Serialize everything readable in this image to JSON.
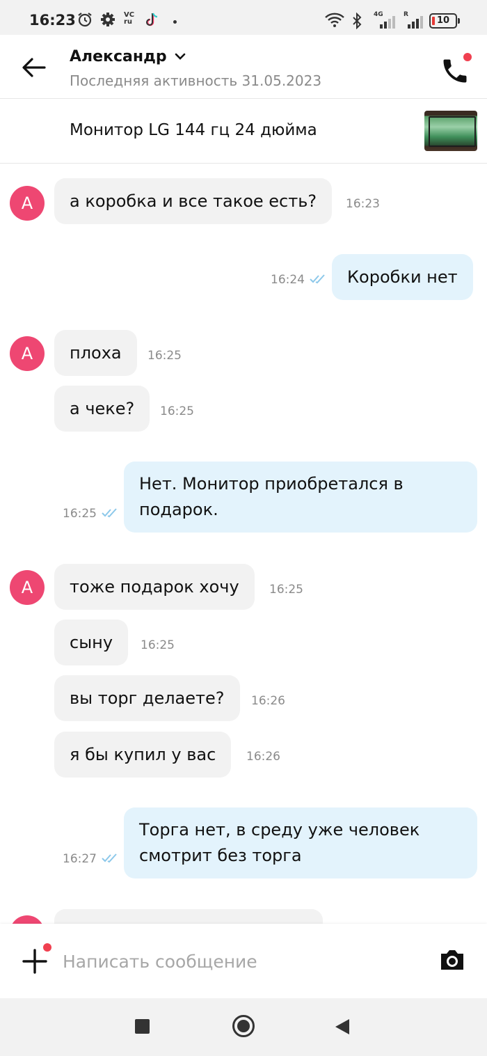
{
  "status_bar": {
    "time": "16:23",
    "icons": [
      "alarm-icon",
      "settings-icon",
      "vc-ru-icon",
      "tiktok-icon",
      "wifi-icon",
      "bluetooth-icon",
      "signal-4g-icon",
      "signal-roaming-icon"
    ],
    "vc_label": "VC\nru",
    "net_4g": "4G",
    "net_r": "R",
    "battery": "10"
  },
  "header": {
    "contact_name": "Александр",
    "last_activity": "Последняя активность 31.05.2023"
  },
  "item": {
    "title": "Монитор LG 144 гц 24 дюйма"
  },
  "messages": [
    {
      "from": "in",
      "avatar": "A",
      "text": "а коробка и все такое есть?",
      "time": "16:23"
    },
    {
      "from": "out",
      "text": "Коробки нет",
      "time": "16:24"
    },
    {
      "from": "in",
      "avatar": "A",
      "text": "плоха",
      "time": "16:25"
    },
    {
      "from": "in",
      "text": "а чеке?",
      "time": "16:25"
    },
    {
      "from": "out",
      "text": "Нет. Монитор приобретался в подарок.",
      "time": "16:25"
    },
    {
      "from": "in",
      "avatar": "A",
      "text": "тоже подарок хочу",
      "time": "16:25"
    },
    {
      "from": "in",
      "text": "сыну",
      "time": "16:25"
    },
    {
      "from": "in",
      "text": "вы торг делаете?",
      "time": "16:26"
    },
    {
      "from": "in",
      "text": "я бы купил у вас",
      "time": "16:26"
    },
    {
      "from": "out",
      "text": "Торга нет, в среду уже человек смотрит без торга",
      "time": "16:27"
    }
  ],
  "composer": {
    "placeholder": "Написать сообщение"
  },
  "colors": {
    "avatar": "#ee4772",
    "incoming_bubble": "#f2f2f2",
    "outgoing_bubble": "#e3f3fc",
    "read_checks": "#8cc8ea",
    "notification_dot": "#f04050"
  }
}
